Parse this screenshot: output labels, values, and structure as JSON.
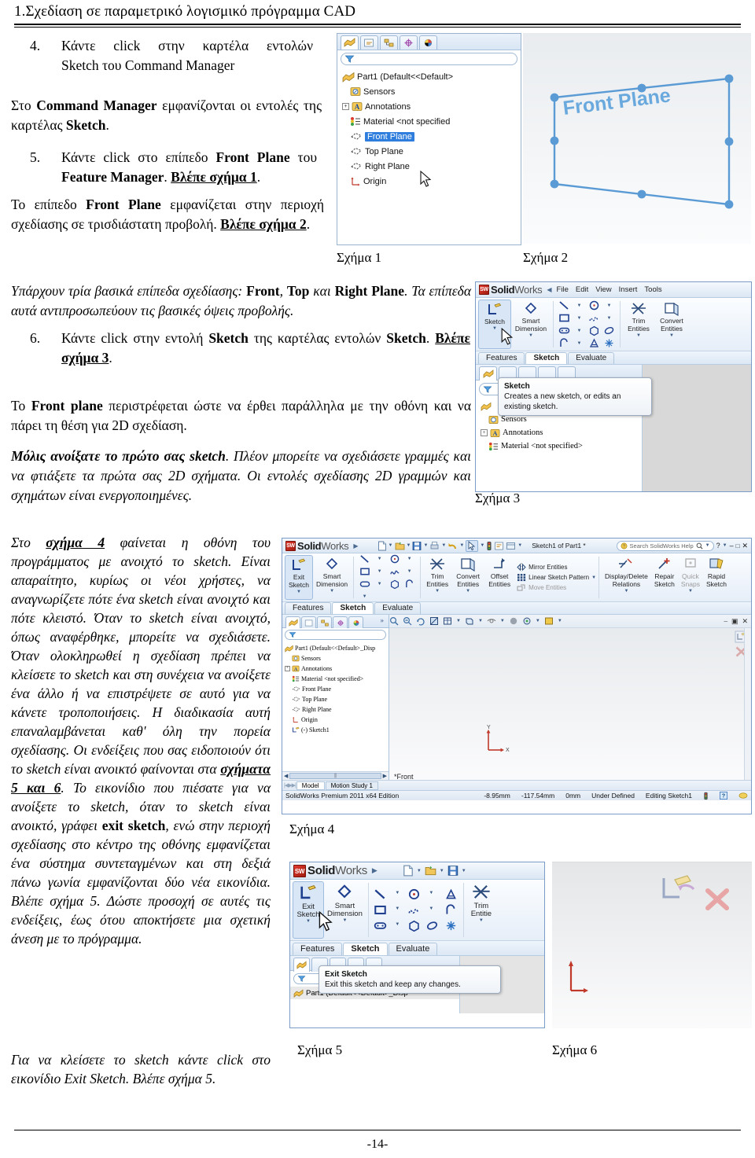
{
  "header": {
    "title": "1.Σχεδίαση σε παραμετρικό λογισμικό πρόγραμμα CAD"
  },
  "footer": {
    "page_number": "-14-"
  },
  "steps": [
    {
      "number": "4.",
      "text_parts": [
        "Κάντε click στην καρτέλα εντολών",
        "Sketch του Command Manager"
      ]
    },
    {
      "number": "5.",
      "text_parts": [
        "Κάντε click στο επίπεδο ",
        "Front Plane",
        " του ",
        "Feature Manager",
        ". ",
        "Βλέπε σχήμα 1",
        "."
      ]
    },
    {
      "number": "6.",
      "text_parts": [
        "Κάντε click στην εντολή ",
        "Sketch",
        " της καρτέλας εντολών ",
        "Sketch",
        ". ",
        "Βλέπε σχήμα 3",
        "."
      ]
    }
  ],
  "paragraphs": {
    "p1_a": "Στο ",
    "p1_b": "Command Manager",
    "p1_c": " εμφανίζονται οι εντολές της καρτέλας ",
    "p1_d": "Sketch",
    "p1_e": ".",
    "p2_a": "Το επίπεδο ",
    "p2_b": "Front Plane",
    "p2_c": " εμφανίζεται στην περιοχή σχεδίασης σε τρισδιάστατη προβολή. ",
    "p2_d": "Βλέπε σχήμα 2",
    "p2_e": ".",
    "p3_a": "Υπάρχουν τρία βασικά επίπεδα σχεδίασης: ",
    "p3_b": "Front",
    "p3_c": ", ",
    "p3_d": "Top",
    "p3_e": " και ",
    "p3_f": "Right Plane",
    "p3_g": ". Τα επίπεδα αυτά αντιπροσωπεύουν τις βασικές όψεις προβολής.",
    "p4_a": "Το ",
    "p4_b": "Front plane",
    "p4_c": " περιστρέφεται ώστε να έρθει παράλληλα με την οθόνη και να πάρει τη θέση για 2D σχεδίαση.",
    "p5_a": "Μόλις ανοίξατε το πρώτο σας sketch",
    "p5_b": ". Πλέον μπορείτε να σχεδιάσετε γραμμές και να φτιάξετε τα πρώτα σας 2D σχήματα. Οι εντολές σχεδίασης 2D γραμμών και σχημάτων είναι ενεργοποιημένες.",
    "p6_a": "Στο ",
    "p6_b": "σχήμα 4",
    "p6_c": " φαίνεται η οθόνη του προγράμματος με ανοιχτό το sketch. Είναι απαραίτητο, κυρίως οι νέοι χρήστες, να αναγνωρίζετε πότε ένα sketch είναι ανοιχτό και πότε κλειστό. Όταν το sketch είναι ανοιχτό, όπως αναφέρθηκε, μπορείτε να σχεδιάσετε. Όταν ολοκληρωθεί η σχεδίαση πρέπει να κλείσετε το sketch και στη συνέχεια να ανοίξετε ένα άλλο ή να επιστρέψετε σε αυτό για να κάνετε τροποποιήσεις. Η διαδικασία αυτή επαναλαμβάνεται καθ' όλη την πορεία σχεδίασης. Οι ενδείξεις που σας ειδοποιούν ότι το sketch είναι ανοικτό φαίνονται στα ",
    "p6_d": "σχήματα 5 και 6",
    "p6_e": ". Το εικονίδιο που πιέσατε για να ανοίξετε το sketch, όταν το sketch είναι ανοικτό, γράφει ",
    "p6_f": "exit sketch",
    "p6_g": ", ενώ στην περιοχή σχεδίασης στο κέντρο της οθόνης εμφανίζεται ένα σύστημα συντεταγμένων και στη δεξιά πάνω γωνία εμφανίζονται δύο νέα εικονίδια. Βλέπε σχήμα 5. Δώστε προσοχή σε αυτές τις ενδείξεις, έως ότου αποκτήσετε μια σχετική άνεση με το πρόγραμμα.",
    "p7_a": "Για να κλείσετε το sketch ",
    "p7_b": "κάντε",
    "p7_c": " click στο εικονίδιο Exit Sketch. ",
    "p7_d": "Βλέπε σχήμα 5."
  },
  "captions": {
    "fig1": "Σχήμα 1",
    "fig2": "Σχήμα 2",
    "fig3": "Σχήμα 3",
    "fig4": "Σχήμα 4",
    "fig5": "Σχήμα 5",
    "fig6": "Σχήμα 6"
  },
  "figure1": {
    "tree": [
      {
        "label": "Part1  (Default<<Default>",
        "icon": "part-icon",
        "selected": false,
        "expand": false
      },
      {
        "label": "Sensors",
        "icon": "sensors-icon",
        "selected": false,
        "expand": false
      },
      {
        "label": "Annotations",
        "icon": "annotations-icon",
        "selected": false,
        "expand": true
      },
      {
        "label": "Material <not specified",
        "icon": "material-icon",
        "selected": false,
        "expand": false
      },
      {
        "label": "Front Plane",
        "icon": "plane-icon",
        "selected": true,
        "expand": false
      },
      {
        "label": "Top Plane",
        "icon": "plane-icon",
        "selected": false,
        "expand": false
      },
      {
        "label": "Right Plane",
        "icon": "plane-icon",
        "selected": false,
        "expand": false
      },
      {
        "label": "Origin",
        "icon": "origin-icon",
        "selected": false,
        "expand": false
      }
    ],
    "selection_color": "#2f7ede"
  },
  "figure2": {
    "plane_label": "Front Plane",
    "plane_color": "#5b9bd5"
  },
  "figure3": {
    "app_name_solid": "Solid",
    "app_name_works": "Works",
    "menu": [
      "File",
      "Edit",
      "View",
      "Insert",
      "Tools"
    ],
    "ribbon_buttons": [
      {
        "label_line1": "Sketch",
        "label_line2": "",
        "icon": "sketch-icon",
        "selected": true
      },
      {
        "label_line1": "Smart",
        "label_line2": "Dimension",
        "icon": "smart-dimension-icon",
        "selected": false
      },
      {
        "label_line1": "Trim",
        "label_line2": "Entities",
        "icon": "trim-icon",
        "selected": false
      },
      {
        "label_line1": "Convert",
        "label_line2": "Entities",
        "icon": "convert-icon",
        "selected": false
      }
    ],
    "tabs": [
      {
        "label": "Features",
        "active": false
      },
      {
        "label": "Sketch",
        "active": true
      },
      {
        "label": "Evaluate",
        "active": false
      }
    ],
    "tooltip": {
      "title": "Sketch",
      "body": "Creates a new sketch, or edits an existing sketch."
    },
    "tree": [
      {
        "label": "Sensors",
        "icon": "sensors-icon"
      },
      {
        "label": "Annotations",
        "icon": "annotations-icon"
      },
      {
        "label": "Material <not specified>",
        "icon": "material-icon"
      }
    ]
  },
  "figure4": {
    "app_name_solid": "Solid",
    "app_name_works": "Works",
    "document_title": "Sketch1 of Part1 *",
    "search_placeholder": "Search SolidWorks Help",
    "ribbon_buttons": [
      {
        "label_line1": "Exit",
        "label_line2": "Sketch",
        "icon": "exit-sketch-icon",
        "selected": true
      },
      {
        "label_line1": "Smart",
        "label_line2": "Dimension",
        "icon": "smart-dimension-icon",
        "selected": false
      },
      {
        "label_line1": "Trim",
        "label_line2": "Entities",
        "icon": "trim-icon",
        "selected": false
      },
      {
        "label_line1": "Convert",
        "label_line2": "Entities",
        "icon": "convert-icon",
        "selected": false
      },
      {
        "label_line1": "Offset",
        "label_line2": "Entities",
        "icon": "offset-icon",
        "selected": false
      },
      {
        "label_line1": "Display/Delete",
        "label_line2": "Relations",
        "icon": "display-delete-relations-icon",
        "selected": false
      },
      {
        "label_line1": "Repair",
        "label_line2": "Sketch",
        "icon": "repair-sketch-icon",
        "selected": false
      },
      {
        "label_line1": "Quick",
        "label_line2": "Snaps",
        "icon": "quick-snaps-icon",
        "selected": false
      },
      {
        "label_line1": "Rapid",
        "label_line2": "Sketch",
        "icon": "rapid-sketch-icon",
        "selected": false
      }
    ],
    "mirror_group": [
      "Mirror Entities",
      "Linear Sketch Pattern",
      "Move Entities"
    ],
    "tabs": [
      {
        "label": "Features",
        "active": false
      },
      {
        "label": "Sketch",
        "active": true
      },
      {
        "label": "Evaluate",
        "active": false
      }
    ],
    "tree": [
      {
        "label": "Part1  (Default<<Default>_Disp",
        "icon": "part-icon",
        "expand": false
      },
      {
        "label": "Sensors",
        "icon": "sensors-icon",
        "expand": false
      },
      {
        "label": "Annotations",
        "icon": "annotations-icon",
        "expand": true
      },
      {
        "label": "Material <not specified>",
        "icon": "material-icon",
        "expand": false
      },
      {
        "label": "Front Plane",
        "icon": "plane-icon",
        "expand": false
      },
      {
        "label": "Top Plane",
        "icon": "plane-icon",
        "expand": false
      },
      {
        "label": "Right Plane",
        "icon": "plane-icon",
        "expand": false
      },
      {
        "label": "Origin",
        "icon": "origin-icon",
        "expand": false
      },
      {
        "label": "(-) Sketch1",
        "icon": "sketch1-icon",
        "expand": false
      }
    ],
    "view_label": "*Front",
    "bottom_tabs": [
      "Model",
      "Motion Study 1"
    ],
    "status_bar": {
      "edition": "SolidWorks Premium 2011 x64 Edition",
      "coord_x": "-8.95mm",
      "coord_y": "-117.54mm",
      "coord_z": "0mm",
      "state": "Under Defined",
      "editing": "Editing Sketch1"
    },
    "axis_x": "X",
    "axis_y": "Y"
  },
  "figure5": {
    "app_name_solid": "Solid",
    "app_name_works": "Works",
    "ribbon_buttons": [
      {
        "label_line1": "Exit",
        "label_line2": "Sketch",
        "icon": "exit-sketch-icon",
        "selected": true
      },
      {
        "label_line1": "Smart",
        "label_line2": "Dimension",
        "icon": "smart-dimension-icon",
        "selected": false
      },
      {
        "label_line1": "Trim",
        "label_line2": "Entitie",
        "icon": "trim-icon",
        "selected": false
      }
    ],
    "tabs": [
      {
        "label": "Features",
        "active": false
      },
      {
        "label": "Sketch",
        "active": true
      },
      {
        "label": "Evaluate",
        "active": false
      }
    ],
    "tooltip": {
      "title": "Exit Sketch",
      "body": "Exit this sketch and keep any changes."
    },
    "tree_row": "Part1  (Default<<Default>_Disp"
  },
  "figure6": {
    "icons": [
      "exit-sketch-corner-icon",
      "cancel-sketch-corner-icon"
    ],
    "axis_origin": "origin-triad"
  }
}
